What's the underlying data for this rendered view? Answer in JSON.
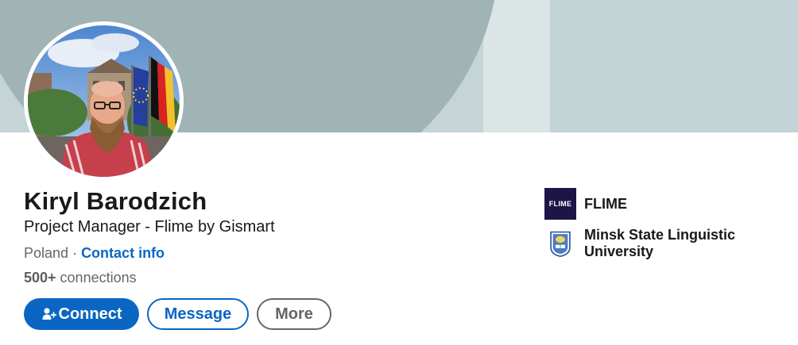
{
  "profile": {
    "name": "Kiryl Barodzich",
    "headline": "Project Manager - Flime by Gismart",
    "location": "Poland",
    "separator": " · ",
    "contact_info_label": "Contact info",
    "connections_count": "500+",
    "connections_label": " connections"
  },
  "actions": {
    "connect_label": "Connect",
    "message_label": "Message",
    "more_label": "More"
  },
  "organizations": [
    {
      "name": "FLIME",
      "logo_text": "FLIME",
      "icon": "flime-logo-icon"
    },
    {
      "name": "Minsk State Linguistic University",
      "icon": "university-crest-icon"
    }
  ],
  "colors": {
    "accent": "#0a66c2",
    "banner": "#a0b3b5",
    "flime_logo_bg": "#1d1448"
  },
  "icons": {
    "connect": "add-person-icon",
    "avatar": "profile-photo"
  }
}
